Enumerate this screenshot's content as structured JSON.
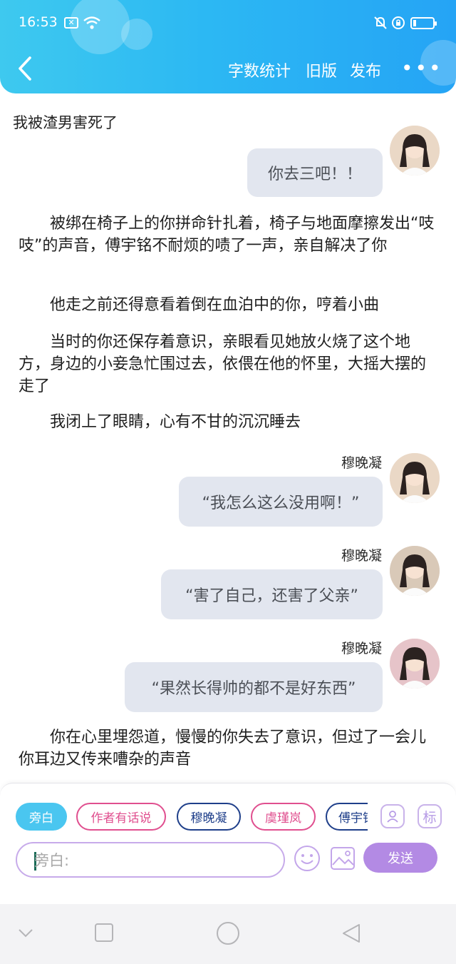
{
  "status_bar": {
    "time": "16:53"
  },
  "header": {
    "nav": {
      "word_count": "字数统计",
      "old_version": "旧版",
      "publish": "发布"
    },
    "more": "•••"
  },
  "content": {
    "title": "我被渣男害死了",
    "first_message": "你去三吧！！",
    "paragraphs": [
      "被绑在椅子上的你拼命针扎着，椅子与地面摩擦发出“吱吱”的声音，傅宇铭不耐烦的啧了一声，亲自解决了你",
      "他走之前还得意看着倒在血泊中的你，哼着小曲",
      "当时的你还保存着意识，亲眼看见她放火烧了这个地方，身边的小妾急忙围过去，依偎在他的怀里，大摇大摆的走了",
      "我闭上了眼睛，心有不甘的沉沉睡去"
    ],
    "messages": [
      {
        "speaker": "穆晚凝",
        "text": "“我怎么这么没用啊！”"
      },
      {
        "speaker": "穆晚凝",
        "text": "“害了自己，还害了父亲”"
      },
      {
        "speaker": "穆晚凝",
        "text": "“果然长得帅的都不是好东西”"
      }
    ],
    "last_paragraph": "你在心里埋怨道，慢慢的你失去了意识，但过了一会儿你耳边又传来嘈杂的声音"
  },
  "composer": {
    "roles": [
      "旁白",
      "作者有话说",
      "穆晚凝",
      "虞瑾岚",
      "傅宇铭"
    ],
    "role_tool_icon": "person-card-icon",
    "tag_button": "标",
    "input_placeholder": "旁白:",
    "send": "发送"
  },
  "colors": {
    "header": "#2cb8f3",
    "accent_pink": "#e04f8f",
    "accent_navy": "#1f3f8a",
    "send": "#b38ae4",
    "bubble": "#e2e6ef"
  }
}
